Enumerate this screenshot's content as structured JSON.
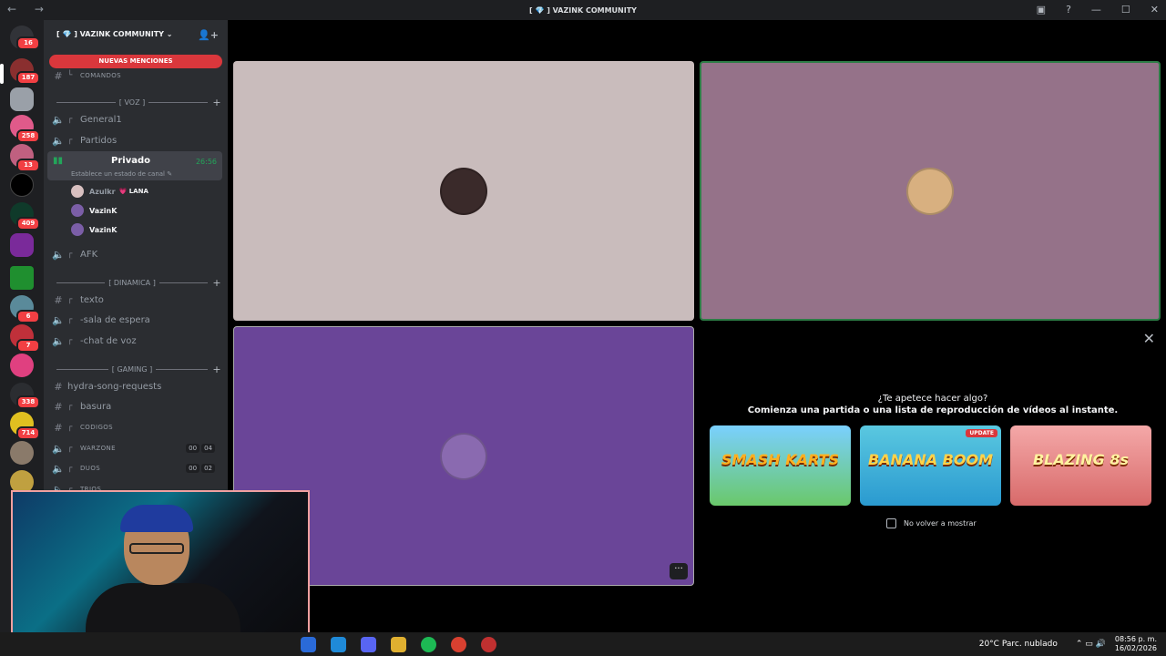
{
  "window": {
    "title": "[ 💎 ] VAZINK COMMUNITY"
  },
  "guild_rail": {
    "badges": [
      "16",
      "187",
      "258",
      "13",
      "409",
      "6",
      "7",
      "338",
      "714"
    ]
  },
  "sidebar": {
    "server_name": "[ 💎 ] VAZINK COMMUNITY ⌄",
    "new_mentions": "NUEVAS MENCIONES",
    "channels": {
      "comandos": "COMANDOS",
      "voz_cat": "[ VOZ ]",
      "general1": "General1",
      "partidos": "Partidos",
      "privado": "Privado",
      "privado_time": "26:56",
      "privado_status": "Establece un estado de canal ✎",
      "afk": "AFK",
      "dinamica_cat": "[ DINAMICA ]",
      "texto": "texto",
      "sala_espera": "-sala de espera",
      "chat_voz": "-chat de voz",
      "gaming_cat": "[ GAMING ]",
      "hydra": "hydra-song-requests",
      "basura": "basura",
      "codigos": "CODIGOS",
      "warzone": "WARZONE",
      "warzone_a": "00",
      "warzone_b": "04",
      "duos": "DUOS",
      "duos_a": "00",
      "duos_b": "02",
      "trios": "TRIOS"
    },
    "members": [
      {
        "name": "Azulkr",
        "tag": "💗 LANA"
      },
      {
        "name": "VazinK"
      },
      {
        "name": "VazinK"
      }
    ]
  },
  "activity": {
    "question": "¿Te apetece hacer algo?",
    "subtitle": "Comienza una partida o una lista de reproducción de vídeos al instante.",
    "games": [
      {
        "name": "SMASH KARTS"
      },
      {
        "name": "BANANA BOOM",
        "badge": "UPDATE"
      },
      {
        "name": "BLAZING 8s"
      }
    ],
    "dont_show": "No volver a mostrar"
  },
  "taskbar": {
    "weather": "20°C  Parc. nublado",
    "time": "08:56 p. m.",
    "date": "16/02/2026"
  },
  "colors": {
    "tile1": "#c9bcbc",
    "tile2": "#957289",
    "tile3": "#6a4598",
    "accent_green": "#23a55a",
    "badge_red": "#f23f43"
  }
}
